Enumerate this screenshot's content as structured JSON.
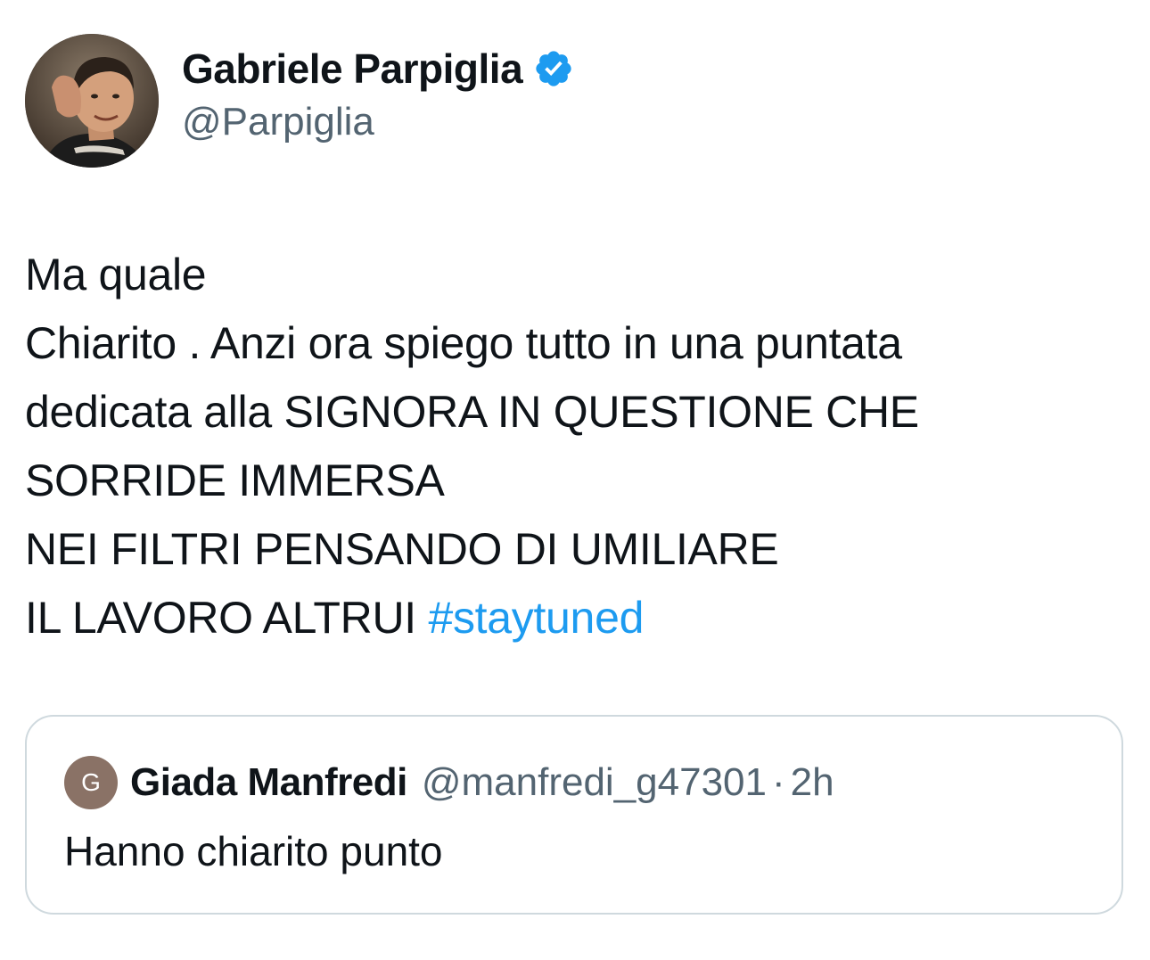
{
  "author": {
    "display_name": "Gabriele Parpiglia",
    "handle": "@Parpiglia",
    "verified": true,
    "verified_color": "#1d9bf0"
  },
  "tweet": {
    "lines": [
      "Ma quale",
      "Chiarito . Anzi ora spiego tutto in una puntata",
      "dedicata alla SIGNORA IN QUESTIONE CHE",
      "SORRIDE IMMERSA",
      "NEI FILTRI PENSANDO DI UMILIARE",
      "IL LAVORO ALTRUI "
    ],
    "hashtag": "#staytuned",
    "hashtag_color": "#1d9bf0"
  },
  "quoted_tweet": {
    "avatar_letter": "G",
    "display_name": "Giada Manfredi",
    "handle": "@manfredi_g47301",
    "separator": "·",
    "time": "2h",
    "text": "Hanno chiarito punto"
  },
  "colors": {
    "text_primary": "#0f1419",
    "text_secondary": "#536471",
    "border": "#cfd9de"
  }
}
